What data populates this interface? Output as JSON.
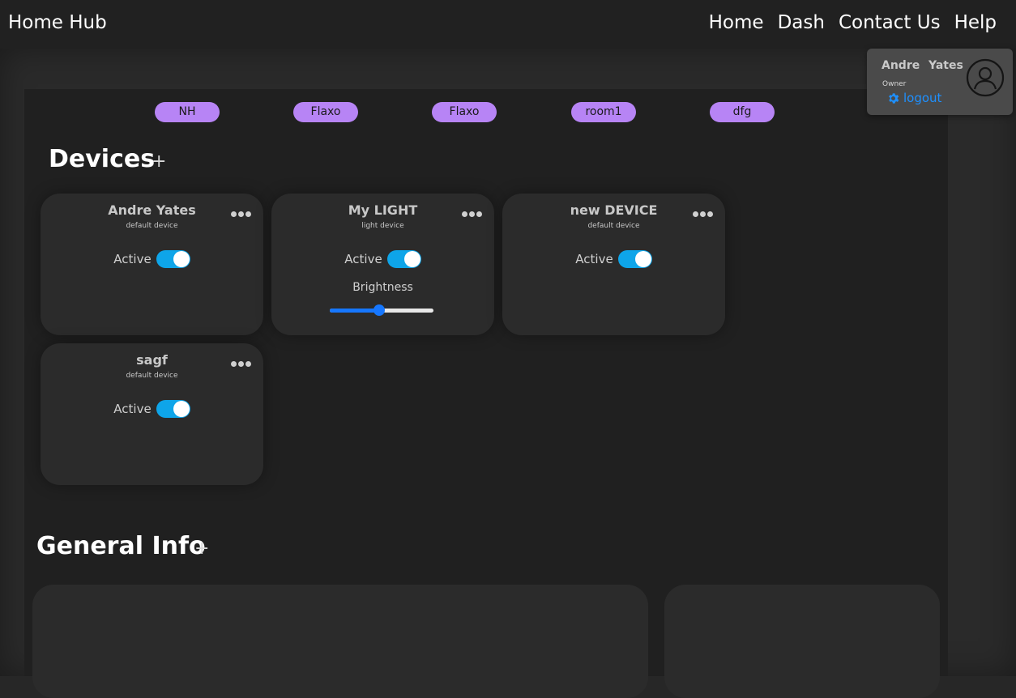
{
  "navbar": {
    "brand": "Home Hub",
    "links": [
      "Home",
      "Dash",
      "Contact Us",
      "Help"
    ]
  },
  "rooms": [
    "NH",
    "Flaxo",
    "Flaxo",
    "room1",
    "dfg"
  ],
  "devices_section": {
    "title": "Devices",
    "add_symbol": "+"
  },
  "devices": [
    {
      "name": "Andre Yates",
      "type": "default device",
      "active_label": "Active",
      "active": true
    },
    {
      "name": "My LIGHT",
      "type": "light device",
      "active_label": "Active",
      "active": true,
      "brightness_label": "Brightness",
      "brightness": 0.48
    },
    {
      "name": "new DEVICE",
      "type": "default device",
      "active_label": "Active",
      "active": true
    },
    {
      "name": "sagf",
      "type": "default device",
      "active_label": "Active",
      "active": true
    }
  ],
  "general_info": {
    "title": "General Info",
    "add_symbol": "+"
  },
  "profile": {
    "first_name": "Andre",
    "last_name": "Yates",
    "role": "Owner",
    "logout_label": "logout"
  },
  "colors": {
    "room_pill": "#b784f5",
    "toggle_on": "#0ea5e9",
    "slider": "#1677ff",
    "logout": "#1e90ff"
  }
}
